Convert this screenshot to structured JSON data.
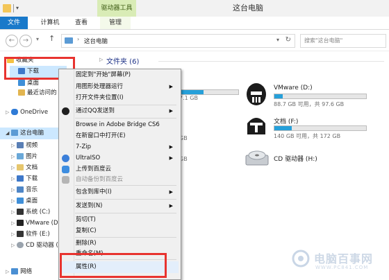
{
  "window": {
    "title": "这台电脑",
    "tool_tab": "驱动器工具"
  },
  "ribbon": {
    "tabs": [
      "文件",
      "计算机",
      "查看",
      "管理"
    ]
  },
  "address": {
    "path": "这台电脑",
    "search_placeholder": "搜索\"这台电脑\""
  },
  "nav": {
    "favorites": "收藏夹",
    "downloads": "下载",
    "desktop": "桌面",
    "recent": "最近访问的",
    "onedrive": "OneDrive",
    "this_pc": "这台电脑",
    "items": [
      "视频",
      "图片",
      "文档",
      "下载",
      "音乐",
      "桌面",
      "系统 (C:)",
      "VMware (D:)",
      "软件 (E:)",
      "CD 驱动器 (",
      "网络"
    ]
  },
  "content": {
    "group_header": "文件夹 (6)",
    "drives": [
      {
        "name": "VMware (D:)",
        "free": "88.7 GB 可用，共 97.6 GB",
        "used_fraction": 0.09
      },
      {
        "name": "文档 (F:)",
        "free": "140 GB 可用，共 172 GB",
        "used_fraction": 0.19
      },
      {
        "name": "CD 驱动器 (H:)"
      }
    ],
    "partial_texts": [
      "7.1 GB",
      "GB",
      "GB"
    ]
  },
  "menu": {
    "items": [
      {
        "label": "固定到\"开始\"屏幕(P)",
        "arrow": false,
        "disabled": false
      },
      {
        "label": "用图形处理器运行",
        "arrow": true,
        "disabled": false
      },
      {
        "label": "打开文件夹位置(I)",
        "arrow": false,
        "disabled": false
      },
      {
        "label": "通过QQ发送到",
        "arrow": true,
        "disabled": false
      },
      {
        "label": "Browse in Adobe Bridge CS6",
        "arrow": false,
        "disabled": false
      },
      {
        "label": "在新窗口中打开(E)",
        "arrow": false,
        "disabled": false
      },
      {
        "label": "7-Zip",
        "arrow": true,
        "disabled": false
      },
      {
        "label": "UltraISO",
        "arrow": true,
        "disabled": false
      },
      {
        "label": "上传到百度云",
        "arrow": false,
        "disabled": false
      },
      {
        "label": "自动备份到百度云",
        "arrow": false,
        "disabled": true
      },
      {
        "label": "包含到库中(I)",
        "arrow": true,
        "disabled": false
      },
      {
        "label": "发送到(N)",
        "arrow": true,
        "disabled": false
      },
      {
        "label": "剪切(T)",
        "arrow": false,
        "disabled": false
      },
      {
        "label": "复制(C)",
        "arrow": false,
        "disabled": false
      },
      {
        "label": "删除(R)",
        "arrow": false,
        "disabled": false
      },
      {
        "label": "重命名(M)",
        "arrow": false,
        "disabled": false
      },
      {
        "label": "属性(R)",
        "arrow": false,
        "disabled": false
      }
    ]
  },
  "watermark": {
    "name": "电脑百事网",
    "url": "WWW.PC841.COM"
  },
  "colors": {
    "accent": "#1979ca",
    "tool_tab": "#d9ecb6",
    "highlight": "#e8332f",
    "bar": "#26a0da"
  }
}
